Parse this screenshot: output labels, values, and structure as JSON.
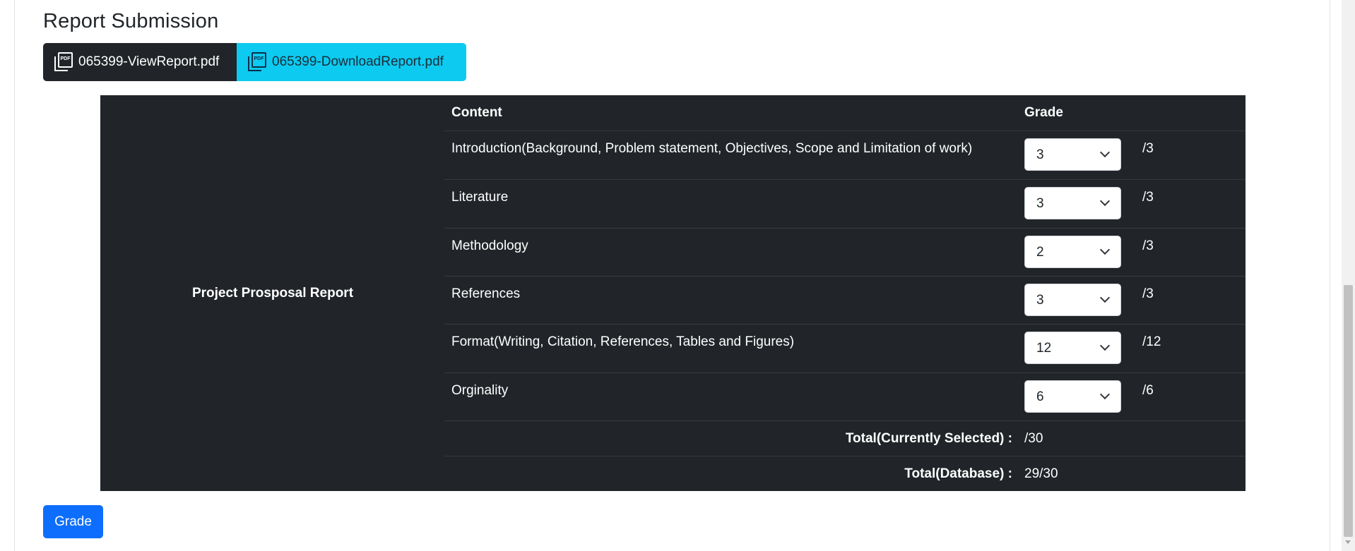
{
  "page": {
    "title": "Report Submission"
  },
  "files": {
    "view_label": "065399-ViewReport.pdf",
    "download_label": "065399-DownloadReport.pdf",
    "icon": "file-pdf-icon",
    "pdf_badge": "PDF"
  },
  "table": {
    "section_label": "Project Prosposal Report",
    "headers": {
      "content": "Content",
      "grade": "Grade"
    },
    "criteria": [
      {
        "name": "Introduction(Background, Problem statement, Objectives, Scope and Limitation of work)",
        "selected": "3",
        "max": "/3"
      },
      {
        "name": "Literature",
        "selected": "3",
        "max": "/3"
      },
      {
        "name": "Methodology",
        "selected": "2",
        "max": "/3"
      },
      {
        "name": "References",
        "selected": "3",
        "max": "/3"
      },
      {
        "name": "Format(Writing, Citation, References, Tables and Figures)",
        "selected": "12",
        "max": "/12"
      },
      {
        "name": "Orginality",
        "selected": "6",
        "max": "/6"
      }
    ],
    "totals": {
      "current_label": "Total(Currently Selected) :",
      "current_value": "/30",
      "database_label": "Total(Database) :",
      "database_value": "29/30"
    }
  },
  "actions": {
    "grade_label": "Grade"
  },
  "colors": {
    "table_bg": "#212529",
    "primary": "#0d6efd",
    "info": "#0dcaf0",
    "dark": "#212529"
  }
}
